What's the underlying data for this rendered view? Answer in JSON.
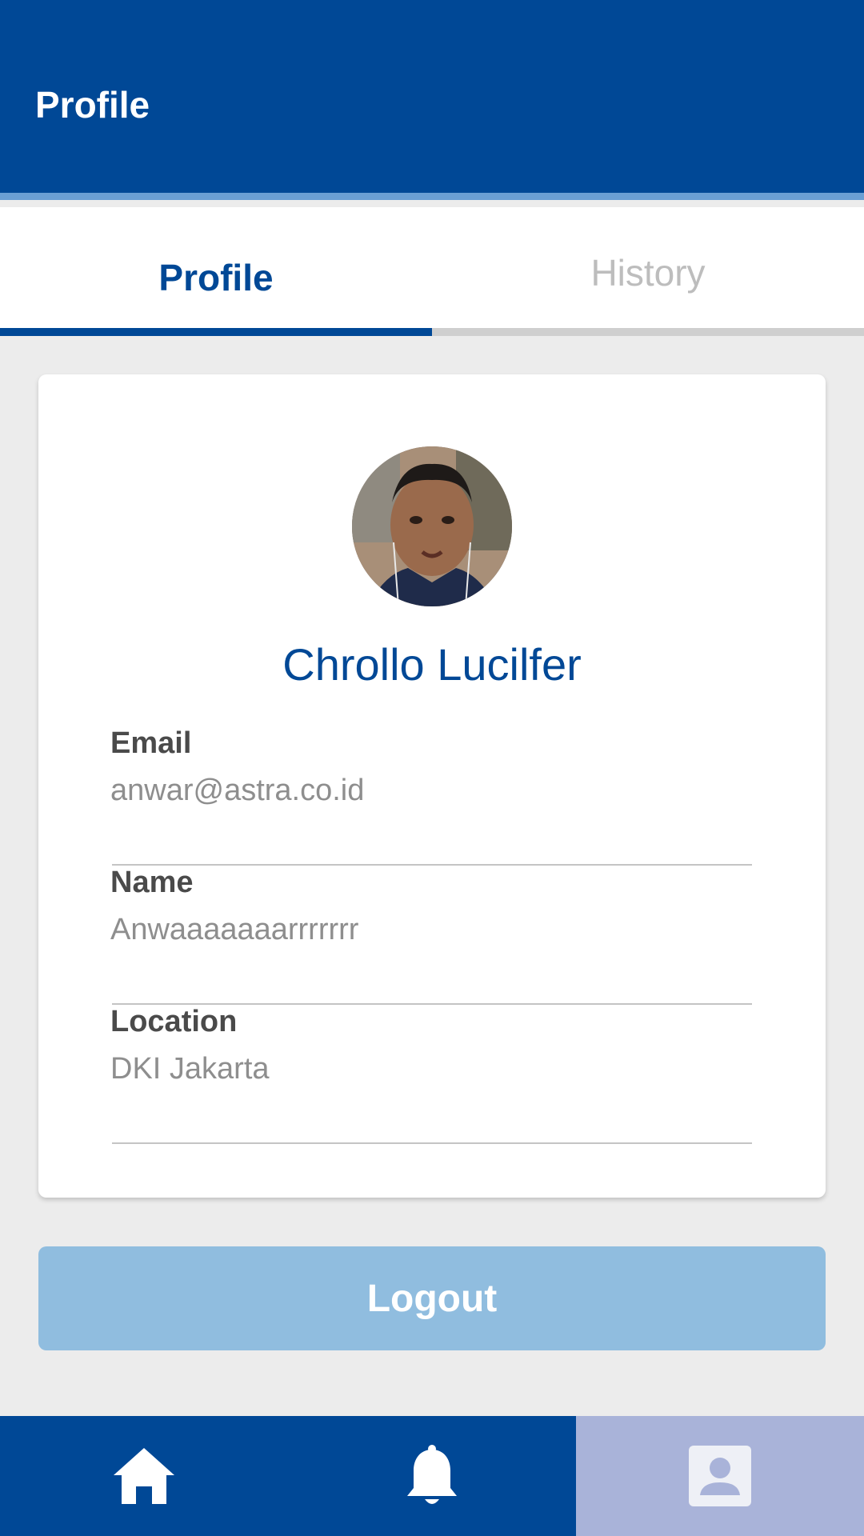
{
  "header": {
    "title": "Profile"
  },
  "tabs": [
    {
      "label": "Profile",
      "active": true
    },
    {
      "label": "History",
      "active": false
    }
  ],
  "profile": {
    "name": "Chrollo Lucilfer",
    "fields": [
      {
        "label": "Email",
        "value": "anwar@astra.co.id"
      },
      {
        "label": "Name",
        "value": "Anwaaaaaaarrrrrrr"
      },
      {
        "label": "Location",
        "value": "DKI Jakarta"
      }
    ]
  },
  "logout": {
    "label": "Logout"
  },
  "bottom_nav": {
    "items": [
      {
        "icon": "home-icon",
        "active": false
      },
      {
        "icon": "bell-icon",
        "active": false
      },
      {
        "icon": "person-icon",
        "active": true
      }
    ]
  },
  "colors": {
    "primary": "#004896",
    "accent_light": "#90bddf",
    "nav_active": "#a9b3d9",
    "background": "#ececec"
  }
}
